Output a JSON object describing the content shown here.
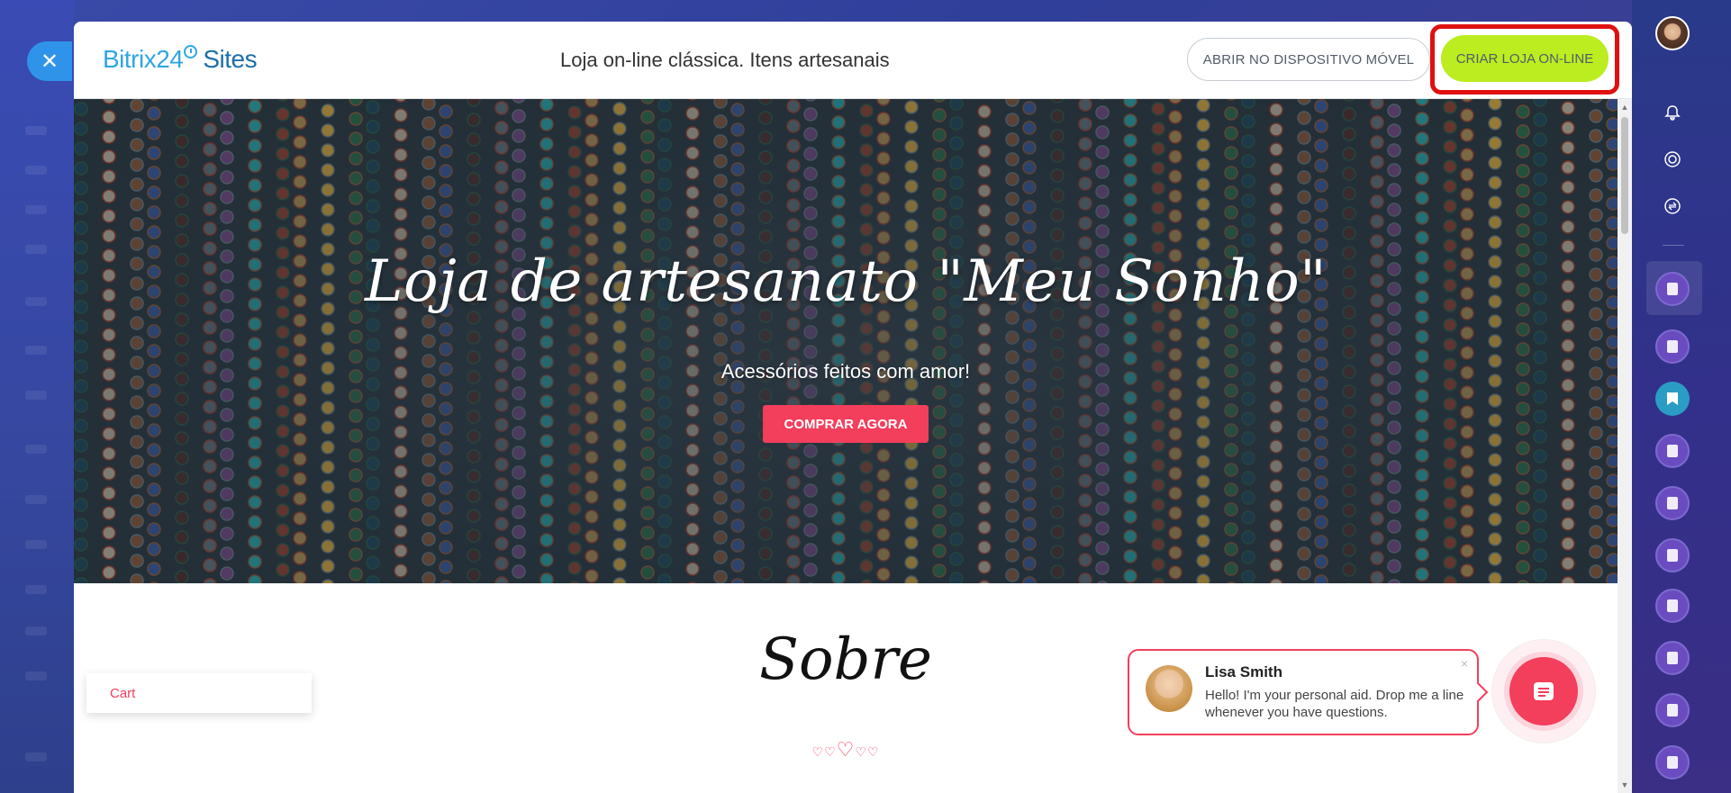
{
  "header": {
    "logo": {
      "brand": "Bitrix24",
      "product": "Sites"
    },
    "title": "Loja on-line clássica. Itens artesanais",
    "mobile_button": "ABRIR NO DISPOSITIVO MÓVEL",
    "create_button": "CRIAR LOJA ON-LINE",
    "close_icon": "close-icon"
  },
  "hero": {
    "title": "Loja de artesanato \"Meu Sonho\"",
    "subtitle": "Acessórios feitos com amor!",
    "button": "COMPRAR AGORA"
  },
  "about": {
    "title": "Sobre",
    "hearts_icon": "hearts-divider-icon"
  },
  "cart": {
    "label": "Cart"
  },
  "chat": {
    "name": "Lisa Smith",
    "message": "Hello! I'm your personal aid. Drop me a line whenever you have questions.",
    "close": "×"
  },
  "colors": {
    "accent": "#f33e5c",
    "create_button": "#bbed21",
    "highlight_border": "#e01010",
    "logo_blue": "#2fa6e3"
  },
  "sidebar_icons": [
    "bell-icon",
    "target-icon",
    "sync-icon",
    "contact-icon",
    "bookmark-icon"
  ]
}
